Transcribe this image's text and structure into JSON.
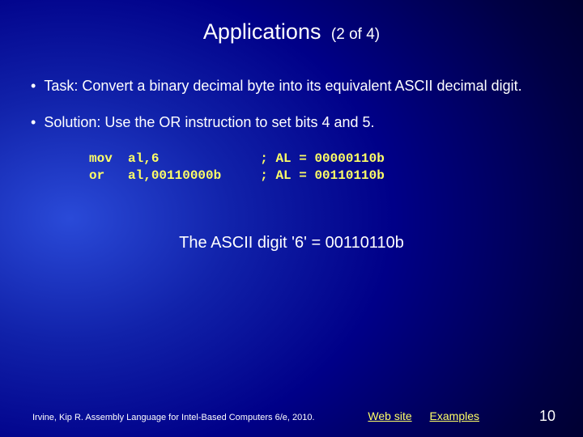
{
  "title": {
    "main": "Applications",
    "sub": "(2 of 4)"
  },
  "bullets": [
    "Task: Convert a binary decimal byte into its equivalent ASCII decimal digit.",
    "Solution: Use the OR instruction to set bits 4 and 5."
  ],
  "code": "mov  al,6             ; AL = 00000110b\nor   al,00110000b     ; AL = 00110110b",
  "caption": "The ASCII digit '6' = 00110110b",
  "footer": {
    "credit": "Irvine, Kip R. Assembly Language for Intel-Based Computers 6/e, 2010.",
    "links": [
      {
        "label": "Web site"
      },
      {
        "label": "Examples"
      }
    ],
    "page": "10"
  }
}
